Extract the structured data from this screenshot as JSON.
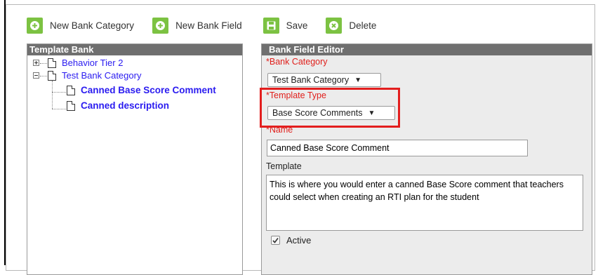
{
  "toolbar": {
    "new_bank_category": "New Bank Category",
    "new_bank_field": "New Bank Field",
    "save": "Save",
    "delete": "Delete"
  },
  "template_bank": {
    "title": "Template Bank",
    "items": [
      {
        "label": "Behavior Tier 2"
      },
      {
        "label": "Test Bank Category"
      },
      {
        "label": "Canned Base Score Comment"
      },
      {
        "label": "Canned description"
      }
    ]
  },
  "editor": {
    "title": "Bank Field Editor",
    "bank_category_label": "*Bank Category",
    "bank_category_value": "Test Bank Category",
    "template_type_label": "*Template Type",
    "template_type_value": "Base Score Comments",
    "name_label": "*Name",
    "name_value": "Canned Base Score Comment",
    "template_label": "Template",
    "template_value": "This is where you would enter a canned Base Score comment that teachers could select when creating an RTI plan for the student",
    "active_label": "Active",
    "active_checked": true
  },
  "colors": {
    "toolbar_icon": "#7cc242",
    "panel_header": "#6f6f6f",
    "required_label": "#e0201c",
    "link": "#2a1bf0",
    "highlight": "#e31e1e"
  }
}
